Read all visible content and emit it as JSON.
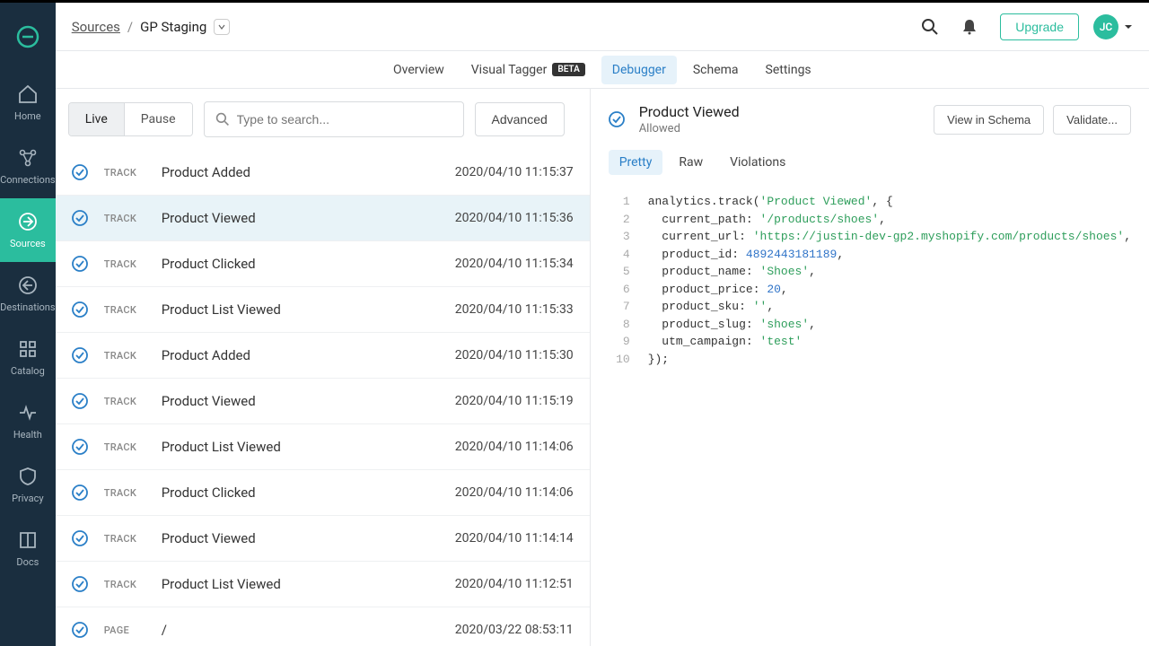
{
  "breadcrumb": {
    "root": "Sources",
    "current": "GP Staging"
  },
  "topbar": {
    "upgrade": "Upgrade",
    "avatar": "JC"
  },
  "tabs": [
    {
      "label": "Overview"
    },
    {
      "label": "Visual Tagger",
      "badge": "BETA"
    },
    {
      "label": "Debugger",
      "active": true
    },
    {
      "label": "Schema"
    },
    {
      "label": "Settings"
    }
  ],
  "nav": [
    {
      "label": "Home"
    },
    {
      "label": "Connections"
    },
    {
      "label": "Sources",
      "active": true
    },
    {
      "label": "Destinations"
    },
    {
      "label": "Catalog"
    },
    {
      "label": "Health"
    },
    {
      "label": "Privacy"
    },
    {
      "label": "Docs"
    }
  ],
  "controls": {
    "live": "Live",
    "pause": "Pause",
    "search_placeholder": "Type to search...",
    "advanced": "Advanced"
  },
  "events": [
    {
      "type": "TRACK",
      "name": "Product Added",
      "time": "2020/04/10 11:15:37"
    },
    {
      "type": "TRACK",
      "name": "Product Viewed",
      "time": "2020/04/10 11:15:36",
      "selected": true
    },
    {
      "type": "TRACK",
      "name": "Product Clicked",
      "time": "2020/04/10 11:15:34"
    },
    {
      "type": "TRACK",
      "name": "Product List Viewed",
      "time": "2020/04/10 11:15:33"
    },
    {
      "type": "TRACK",
      "name": "Product Added",
      "time": "2020/04/10 11:15:30"
    },
    {
      "type": "TRACK",
      "name": "Product Viewed",
      "time": "2020/04/10 11:15:19"
    },
    {
      "type": "TRACK",
      "name": "Product List Viewed",
      "time": "2020/04/10 11:14:06"
    },
    {
      "type": "TRACK",
      "name": "Product Clicked",
      "time": "2020/04/10 11:14:06"
    },
    {
      "type": "TRACK",
      "name": "Product Viewed",
      "time": "2020/04/10 11:14:14"
    },
    {
      "type": "TRACK",
      "name": "Product List Viewed",
      "time": "2020/04/10 11:12:51"
    },
    {
      "type": "PAGE",
      "name": "/",
      "time": "2020/03/22 08:53:11"
    }
  ],
  "detail": {
    "title": "Product Viewed",
    "status": "Allowed",
    "view_schema": "View in Schema",
    "validate": "Validate...",
    "tabs": {
      "pretty": "Pretty",
      "raw": "Raw",
      "violations": "Violations"
    }
  },
  "code": {
    "fn": "analytics.track",
    "event": "'Product Viewed'",
    "props": [
      {
        "k": "current_path",
        "v": "'/products/shoes'",
        "t": "str"
      },
      {
        "k": "current_url",
        "v": "'https://justin-dev-gp2.myshopify.com/products/shoes'",
        "t": "str"
      },
      {
        "k": "product_id",
        "v": "4892443181189",
        "t": "num"
      },
      {
        "k": "product_name",
        "v": "'Shoes'",
        "t": "str"
      },
      {
        "k": "product_price",
        "v": "20",
        "t": "num"
      },
      {
        "k": "product_sku",
        "v": "''",
        "t": "str"
      },
      {
        "k": "product_slug",
        "v": "'shoes'",
        "t": "str"
      },
      {
        "k": "utm_campaign",
        "v": "'test'",
        "t": "str"
      }
    ]
  }
}
